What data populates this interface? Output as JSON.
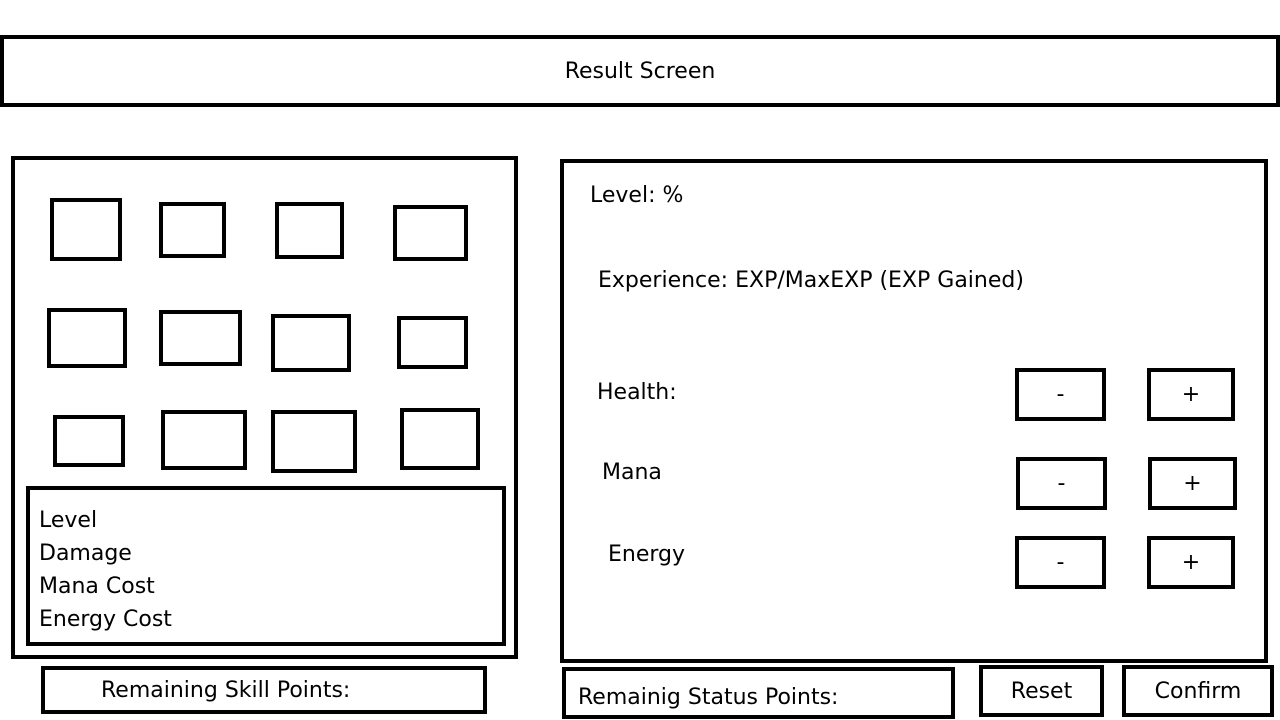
{
  "header": {
    "title": "Result Screen"
  },
  "skills_panel": {
    "info_lines": [
      "Level",
      "Damage",
      "Mana Cost",
      "Energy Cost"
    ],
    "remaining_label": "Remaining Skill Points:"
  },
  "stats_panel": {
    "level_label": "Level: %",
    "experience_label": "Experience: EXP/MaxEXP (EXP Gained)",
    "stats": [
      {
        "name": "Health:",
        "minus": "-",
        "plus": "+"
      },
      {
        "name": "Mana",
        "minus": "-",
        "plus": "+"
      },
      {
        "name": "Energy",
        "minus": "-",
        "plus": "+"
      }
    ],
    "remaining_label": "Remainig Status Points:"
  },
  "footer": {
    "reset_label": "Reset",
    "confirm_label": "Confirm"
  }
}
